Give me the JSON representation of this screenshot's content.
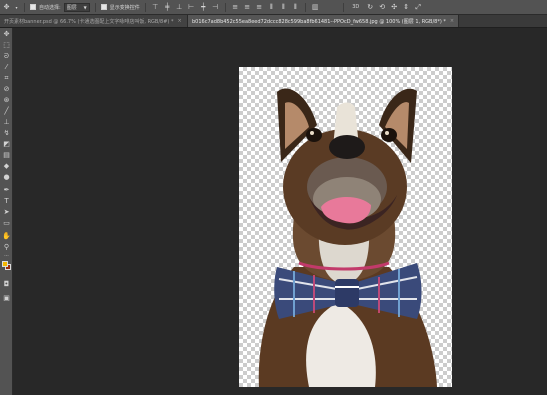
{
  "options_bar": {
    "tool_preset_icon": "move-tool-icon",
    "auto_select_label": "自动选择:",
    "auto_select_target": "图层",
    "show_transform_label": "显示变换控件",
    "colors": {
      "background": "#535353",
      "checkbox": "#e6e6e6"
    }
  },
  "tabs": [
    {
      "label": "开页素材banner.psd @ 66.7% (卡通选图配上文字咏啡店叫饭, RGB/8#) *",
      "close": "×",
      "active": false
    },
    {
      "label": "b016c7ad8b452c55ea8eed72dccc828c599ba8fb61481--PPOcD_fw658.jpg @ 100% (图层 1, RGB/8*) *",
      "close": "×",
      "active": true
    }
  ],
  "toolbar": {
    "tools": [
      "move-tool-icon",
      "marquee-tool-icon",
      "lasso-tool-icon",
      "quick-select-tool-icon",
      "crop-tool-icon",
      "eyedropper-tool-icon",
      "healing-brush-tool-icon",
      "brush-tool-icon",
      "clone-stamp-tool-icon",
      "history-brush-tool-icon",
      "eraser-tool-icon",
      "gradient-tool-icon",
      "blur-tool-icon",
      "dodge-tool-icon",
      "pen-tool-icon",
      "type-tool-icon",
      "path-select-tool-icon",
      "rectangle-tool-icon",
      "hand-tool-icon",
      "zoom-tool-icon",
      "more-tools-icon"
    ],
    "foreground_color": "#f5b700",
    "background_color": "#9b2b0c"
  },
  "canvas": {
    "transparent_checker_colors": [
      "#ffffff",
      "#cccccc"
    ],
    "image_subject": "dog-with-bow-tie"
  }
}
